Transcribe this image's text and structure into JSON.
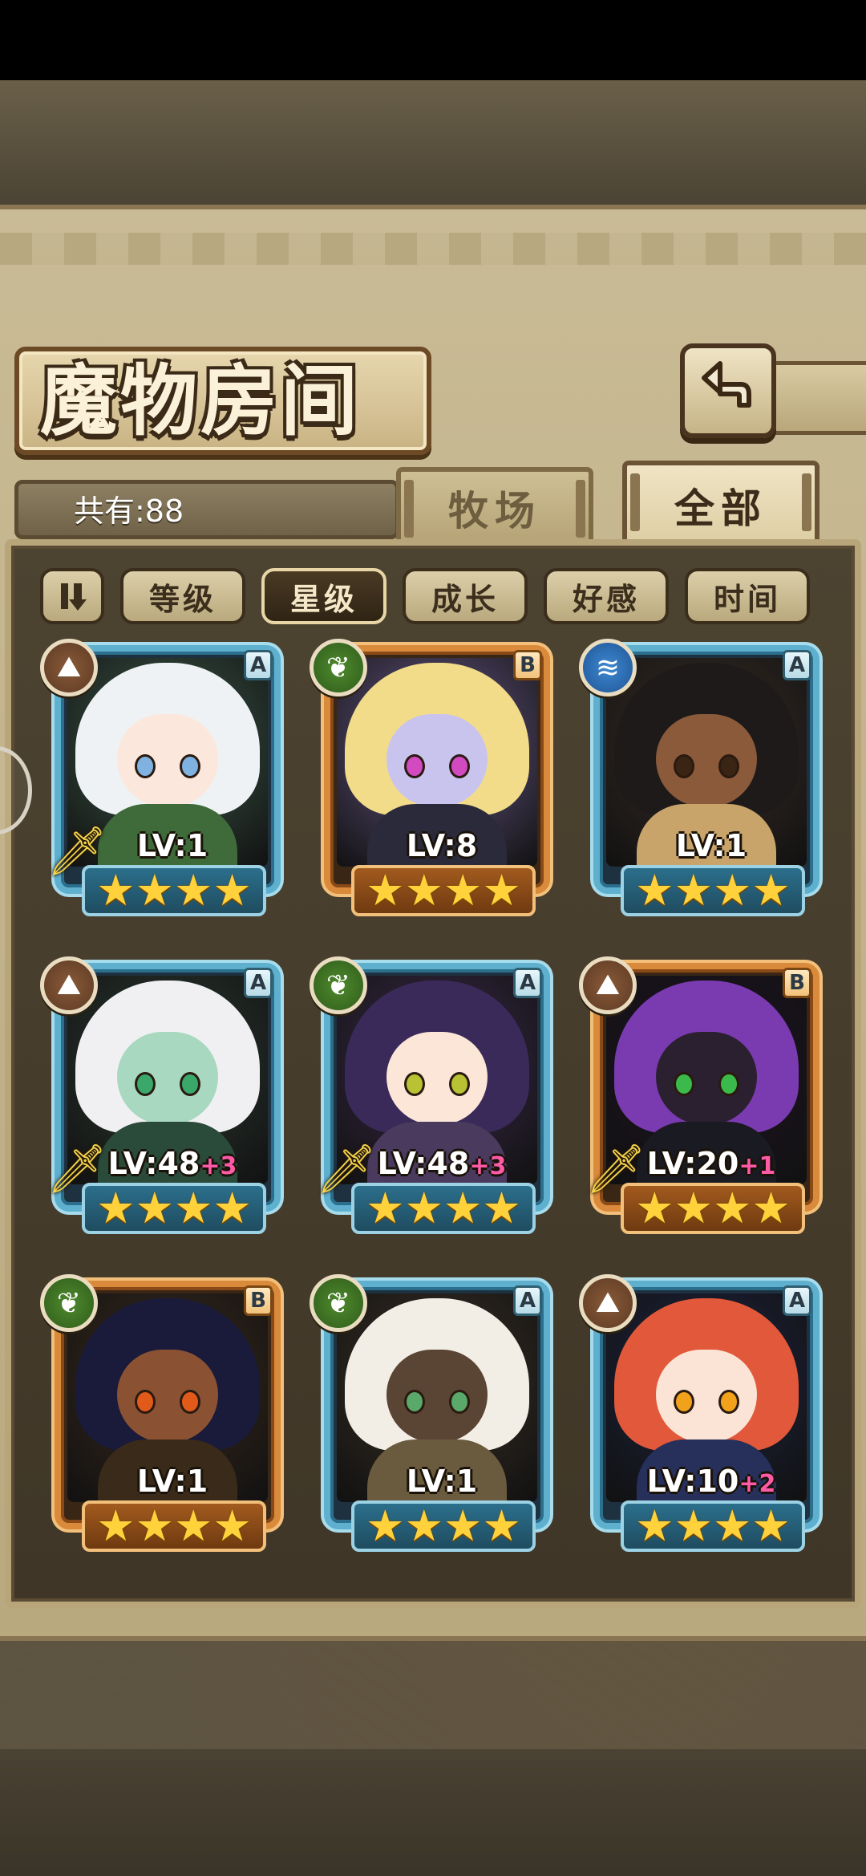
{
  "screen": {
    "title": "魔物房间",
    "count_text": "共有:88",
    "back_icon": "back-arrow-icon"
  },
  "tabs": [
    {
      "label": "牧场",
      "active": false
    },
    {
      "label": "全部",
      "active": true
    }
  ],
  "sort_buttons": [
    {
      "label": "",
      "icon": "sort-order-icon",
      "active": false
    },
    {
      "label": "等级",
      "active": false
    },
    {
      "label": "星级",
      "active": true
    },
    {
      "label": "成长",
      "active": false
    },
    {
      "label": "好感",
      "active": false
    },
    {
      "label": "时间",
      "active": false
    }
  ],
  "monsters": [
    {
      "level": "LV:1",
      "bonus": "",
      "rank": "A",
      "element": "earth",
      "stars": 4,
      "frame": "blue",
      "weapon": true,
      "colors": {
        "bg": "#3d5a4a",
        "hair": "#eef2f4",
        "face": "#fbe7dc",
        "eye": "#7fb2e0",
        "body": "#3f6a3a"
      }
    },
    {
      "level": "LV:8",
      "bonus": "",
      "rank": "B",
      "element": "grass",
      "stars": 4,
      "frame": "orange",
      "weapon": false,
      "colors": {
        "bg": "#6a5a8a",
        "hair": "#f2dc8a",
        "face": "#c9c4ee",
        "eye": "#d24ac0",
        "body": "#2b2a3a"
      }
    },
    {
      "level": "LV:1",
      "bonus": "",
      "rank": "A",
      "element": "water",
      "stars": 4,
      "frame": "blue",
      "weapon": false,
      "colors": {
        "bg": "#3a2e26",
        "hair": "#1e1a1a",
        "face": "#8a5a3a",
        "eye": "#3a2414",
        "body": "#c9a46a"
      }
    },
    {
      "level": "LV:48",
      "bonus": "+3",
      "rank": "A",
      "element": "earth",
      "stars": 4,
      "frame": "blue",
      "weapon": true,
      "colors": {
        "bg": "#2c3a32",
        "hair": "#f0f0f2",
        "face": "#a8d8c0",
        "eye": "#3aa86a",
        "body": "#2a4a3a"
      }
    },
    {
      "level": "LV:48",
      "bonus": "+3",
      "rank": "A",
      "element": "grass",
      "stars": 4,
      "frame": "blue",
      "weapon": true,
      "colors": {
        "bg": "#3a2a4a",
        "hair": "#3a2a5a",
        "face": "#fbe6d8",
        "eye": "#b8c232",
        "body": "#4a3a5e"
      }
    },
    {
      "level": "LV:20",
      "bonus": "+1",
      "rank": "B",
      "element": "earth",
      "stars": 4,
      "frame": "orange",
      "weapon": true,
      "colors": {
        "bg": "#1e1424",
        "hair": "#7a3ab0",
        "face": "#2a2030",
        "eye": "#3aba4a",
        "body": "#1a1a22"
      }
    },
    {
      "level": "LV:1",
      "bonus": "",
      "rank": "B",
      "element": "grass",
      "stars": 4,
      "frame": "orange",
      "weapon": false,
      "colors": {
        "bg": "#3a2a1e",
        "hair": "#1a1a3a",
        "face": "#8a5232",
        "eye": "#e25a1a",
        "body": "#3a2a1a"
      }
    },
    {
      "level": "LV:1",
      "bonus": "",
      "rank": "A",
      "element": "grass",
      "stars": 4,
      "frame": "blue",
      "weapon": false,
      "colors": {
        "bg": "#3a3026",
        "hair": "#f2eee6",
        "face": "#5a4434",
        "eye": "#5aa86a",
        "body": "#6a5a3e"
      }
    },
    {
      "level": "LV:10",
      "bonus": "+2",
      "rank": "A",
      "element": "earth",
      "stars": 4,
      "frame": "blue",
      "weapon": false,
      "colors": {
        "bg": "#1e2440",
        "hair": "#e2583a",
        "face": "#fbe4d6",
        "eye": "#f2a21a",
        "body": "#26305a"
      }
    }
  ]
}
